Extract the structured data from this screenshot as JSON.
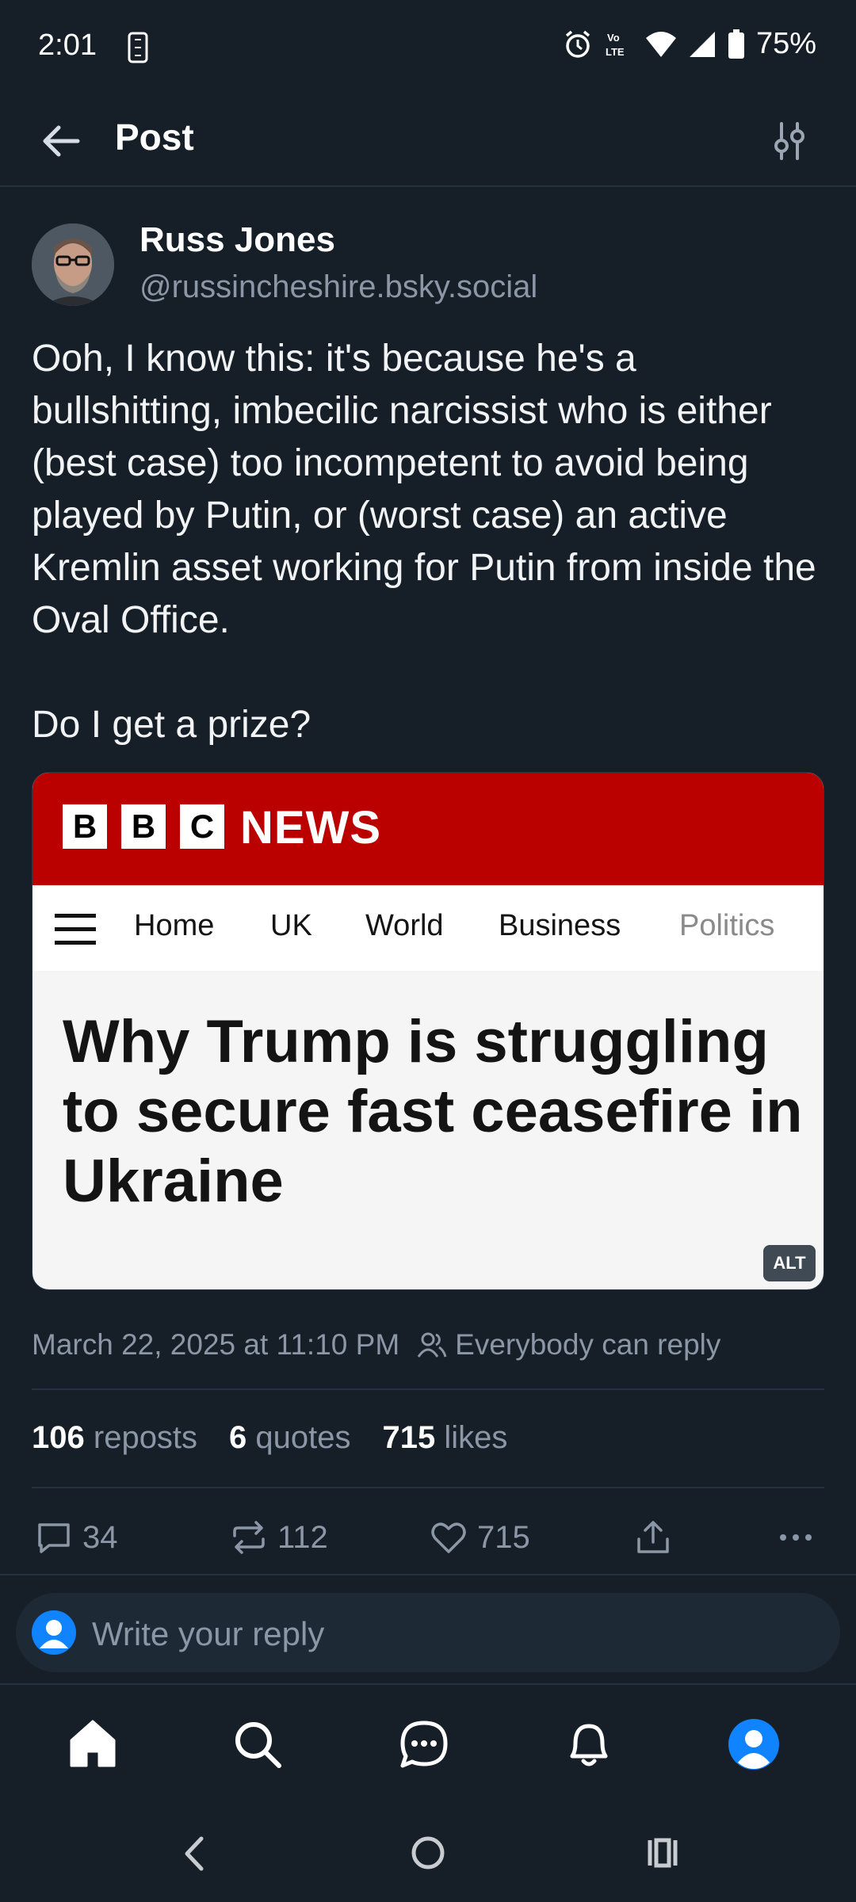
{
  "status_bar": {
    "time": "2:01",
    "battery": "75%"
  },
  "header": {
    "title": "Post"
  },
  "post": {
    "author_name": "Russ Jones",
    "author_handle": "@russincheshire.bsky.social",
    "text": "Ooh, I know this: it's because he's a bullshitting, imbecilic narcissist who is either (best case) too incompetent to avoid being played by Putin, or (worst case) an active Kremlin asset working for Putin from inside the Oval Office.\n\nDo I get a prize?",
    "timestamp": "March 22, 2025 at 11:10 PM",
    "reply_setting": "Everybody can reply"
  },
  "embed": {
    "brand_letters": [
      "B",
      "B",
      "C"
    ],
    "brand_word": "NEWS",
    "nav": [
      "Home",
      "UK",
      "World",
      "Business",
      "Politics"
    ],
    "headline": "Why Trump is struggling to secure fast ceasefire in Ukraine",
    "alt_badge": "ALT"
  },
  "stats": {
    "reposts_count": "106",
    "reposts_label": "reposts",
    "quotes_count": "6",
    "quotes_label": "quotes",
    "likes_count": "715",
    "likes_label": "likes"
  },
  "actions": {
    "replies": "34",
    "reposts": "112",
    "likes": "715"
  },
  "reply": {
    "placeholder": "Write your reply"
  },
  "colors": {
    "background": "#161e27",
    "accent": "#1083fe",
    "bbc_red": "#bb0000",
    "muted": "#8b97a6"
  },
  "icons": {
    "back": "arrow-left-icon",
    "filter": "sliders-icon",
    "reply": "speech-bubble-icon",
    "repost": "repost-arrows-icon",
    "like": "heart-icon",
    "share": "share-icon",
    "more": "ellipsis-icon",
    "home": "home-icon",
    "search": "search-icon",
    "chat": "chat-icon",
    "notifications": "bell-icon",
    "profile": "profile-icon"
  }
}
